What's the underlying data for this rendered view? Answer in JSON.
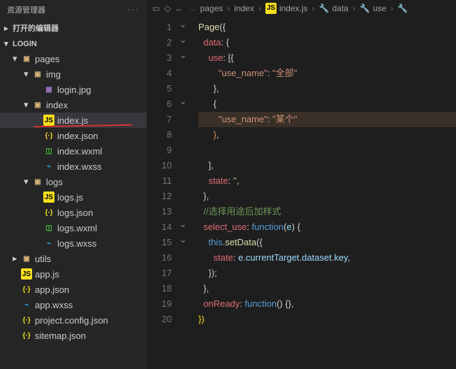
{
  "sidebar": {
    "title": "资源管理器",
    "editors": "打开的编辑器",
    "project": "LOGIN",
    "items": [
      {
        "name": "pages",
        "type": "folder",
        "indent": 1,
        "chev": "▾"
      },
      {
        "name": "img",
        "type": "folder",
        "indent": 2,
        "chev": "▾"
      },
      {
        "name": "login.jpg",
        "type": "img",
        "indent": 3
      },
      {
        "name": "index",
        "type": "folder",
        "indent": 2,
        "chev": "▾"
      },
      {
        "name": "index.js",
        "type": "js",
        "indent": 3,
        "sel": true,
        "underline": true
      },
      {
        "name": "index.json",
        "type": "json",
        "indent": 3
      },
      {
        "name": "index.wxml",
        "type": "wxml",
        "indent": 3
      },
      {
        "name": "index.wxss",
        "type": "wxss",
        "indent": 3
      },
      {
        "name": "logs",
        "type": "folder",
        "indent": 2,
        "chev": "▾"
      },
      {
        "name": "logs.js",
        "type": "js",
        "indent": 3
      },
      {
        "name": "logs.json",
        "type": "json",
        "indent": 3
      },
      {
        "name": "logs.wxml",
        "type": "wxml",
        "indent": 3
      },
      {
        "name": "logs.wxss",
        "type": "wxss",
        "indent": 3
      },
      {
        "name": "utils",
        "type": "folder",
        "indent": 1,
        "chev": "▸"
      },
      {
        "name": "app.js",
        "type": "js",
        "indent": 1
      },
      {
        "name": "app.json",
        "type": "json",
        "indent": 1
      },
      {
        "name": "app.wxss",
        "type": "wxss",
        "indent": 1
      },
      {
        "name": "project.config.json",
        "type": "json",
        "indent": 1
      },
      {
        "name": "sitemap.json",
        "type": "json",
        "indent": 1
      }
    ]
  },
  "breadcrumb": {
    "arrows": {
      "back": "←",
      "fwd": "→"
    },
    "parts": [
      "pages",
      "index",
      "index.js",
      "data",
      "use"
    ],
    "jsBadge": "JS",
    "wrench": "🔧"
  },
  "code": {
    "lines": [
      {
        "n": 1,
        "fold": "⌄",
        "seg": [
          [
            "t-fn",
            "Page"
          ],
          [
            "t-pn",
            "({"
          ]
        ]
      },
      {
        "n": 2,
        "fold": "⌄",
        "seg": [
          [
            "",
            "  "
          ],
          [
            "t-key",
            "data"
          ],
          [
            "t-pn",
            ": {"
          ]
        ]
      },
      {
        "n": 3,
        "fold": "⌄",
        "seg": [
          [
            "",
            "    "
          ],
          [
            "t-key",
            "use"
          ],
          [
            "t-pn",
            ": [{"
          ]
        ]
      },
      {
        "n": 4,
        "fold": "",
        "seg": [
          [
            "",
            "        "
          ],
          [
            "t-str2",
            "\"use_name\""
          ],
          [
            "t-pn",
            ": "
          ],
          [
            "t-str2",
            "\"全部\""
          ]
        ]
      },
      {
        "n": 5,
        "fold": "",
        "seg": [
          [
            "",
            "      "
          ],
          [
            "t-pn",
            "},"
          ]
        ]
      },
      {
        "n": 6,
        "fold": "⌄",
        "seg": [
          [
            "",
            "      "
          ],
          [
            "t-pn",
            "{"
          ]
        ]
      },
      {
        "n": 7,
        "fold": "",
        "hi": true,
        "seg": [
          [
            "",
            "        "
          ],
          [
            "t-str2",
            "\"use_name\""
          ],
          [
            "t-pn",
            ": "
          ],
          [
            "t-str2",
            "\"某个\""
          ]
        ]
      },
      {
        "n": 8,
        "fold": "",
        "seg": [
          [
            "",
            "      "
          ],
          [
            "t-or",
            "}"
          ],
          [
            "t-pn",
            ","
          ]
        ]
      },
      {
        "n": 9,
        "fold": "",
        "seg": [
          [
            "",
            ""
          ]
        ]
      },
      {
        "n": 10,
        "fold": "",
        "seg": [
          [
            "",
            "    "
          ],
          [
            "t-pn",
            "],"
          ]
        ]
      },
      {
        "n": 11,
        "fold": "",
        "seg": [
          [
            "",
            "    "
          ],
          [
            "t-key",
            "state"
          ],
          [
            "t-pn",
            ": "
          ],
          [
            "t-str",
            "''"
          ],
          [
            "t-pn",
            ","
          ]
        ]
      },
      {
        "n": 12,
        "fold": "",
        "seg": [
          [
            "",
            "  "
          ],
          [
            "t-pn",
            "},"
          ]
        ]
      },
      {
        "n": 13,
        "fold": "",
        "seg": [
          [
            "",
            "  "
          ],
          [
            "t-cm",
            "//选择用途后加样式"
          ]
        ]
      },
      {
        "n": 14,
        "fold": "⌄",
        "seg": [
          [
            "",
            "  "
          ],
          [
            "t-key",
            "select_use"
          ],
          [
            "t-pn",
            ": "
          ],
          [
            "t-bl",
            "function"
          ],
          [
            "t-pn",
            "("
          ],
          [
            "t-id",
            "e"
          ],
          [
            "t-pn",
            ") {"
          ]
        ]
      },
      {
        "n": 15,
        "fold": "⌄",
        "seg": [
          [
            "",
            "    "
          ],
          [
            "t-bl",
            "this"
          ],
          [
            "t-pn",
            "."
          ],
          [
            "t-fn",
            "setData"
          ],
          [
            "t-pn",
            "({"
          ]
        ]
      },
      {
        "n": 16,
        "fold": "",
        "seg": [
          [
            "",
            "      "
          ],
          [
            "t-key",
            "state"
          ],
          [
            "t-pn",
            ": "
          ],
          [
            "t-id",
            "e"
          ],
          [
            "t-pn",
            "."
          ],
          [
            "t-id",
            "currentTarget"
          ],
          [
            "t-pn",
            "."
          ],
          [
            "t-id",
            "dataset"
          ],
          [
            "t-pn",
            "."
          ],
          [
            "t-id",
            "key"
          ],
          [
            "t-pn",
            ","
          ]
        ]
      },
      {
        "n": 17,
        "fold": "",
        "seg": [
          [
            "",
            "    "
          ],
          [
            "t-pn",
            "});"
          ]
        ]
      },
      {
        "n": 18,
        "fold": "",
        "seg": [
          [
            "",
            "  "
          ],
          [
            "t-pn",
            "},"
          ]
        ]
      },
      {
        "n": 19,
        "fold": "",
        "seg": [
          [
            "",
            "  "
          ],
          [
            "t-key",
            "onReady"
          ],
          [
            "t-pn",
            ": "
          ],
          [
            "t-bl",
            "function"
          ],
          [
            "t-pn",
            "() {},"
          ]
        ]
      },
      {
        "n": 20,
        "fold": "",
        "seg": [
          [
            "t-yl",
            "})"
          ]
        ]
      }
    ]
  },
  "icons": {
    "folder": "▣",
    "js": "JS",
    "json": "{·}",
    "wxml": "◫",
    "wxss": "⌁",
    "img": "▦"
  }
}
